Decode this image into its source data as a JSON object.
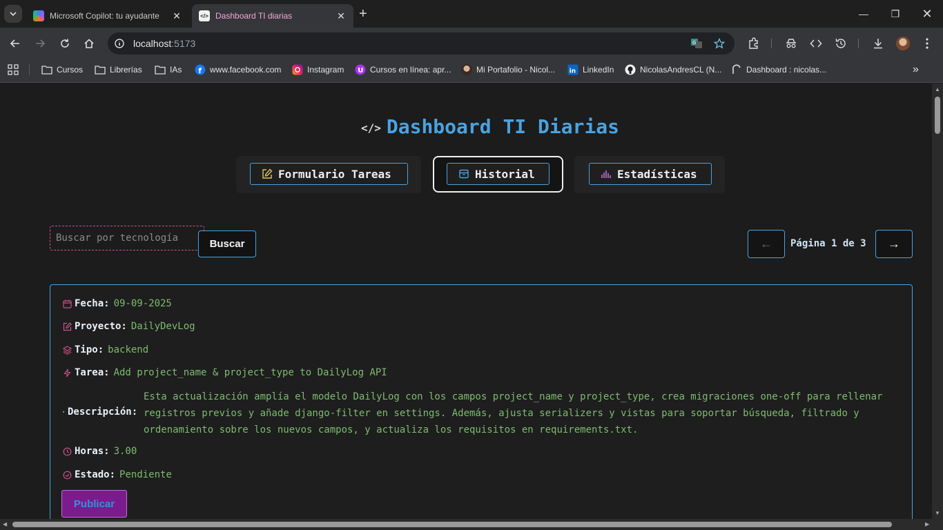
{
  "browser": {
    "tabs": [
      {
        "title": "Microsoft Copilot: tu ayudante"
      },
      {
        "title": "Dashboard TI diarias"
      }
    ],
    "url_host": "localhost",
    "url_port": ":5173",
    "bookmarks": [
      {
        "label": "Cursos"
      },
      {
        "label": "Librerías"
      },
      {
        "label": "IAs"
      },
      {
        "label": "www.facebook.com"
      },
      {
        "label": "Instagram"
      },
      {
        "label": "Cursos en línea: apr..."
      },
      {
        "label": "Mi Portafolio - Nicol..."
      },
      {
        "label": "LinkedIn"
      },
      {
        "label": "NicolasAndresCL (N..."
      },
      {
        "label": "Dashboard : nicolas..."
      }
    ]
  },
  "page": {
    "title": "Dashboard TI Diarias",
    "nav": [
      {
        "label": "Formulario Tareas",
        "icon": "edit-icon"
      },
      {
        "label": "Historial",
        "icon": "archive-icon",
        "active": true
      },
      {
        "label": "Estadísticas",
        "icon": "bar-chart-icon"
      }
    ],
    "search": {
      "placeholder": "Buscar por tecnología",
      "button_label": "Buscar"
    },
    "pagination": {
      "prev": "←",
      "next": "→",
      "text": "Página 1 de 3"
    },
    "entry": {
      "fecha_label": "Fecha:",
      "fecha": "09-09-2025",
      "proyecto_label": "Proyecto:",
      "proyecto": "DailyDevLog",
      "tipo_label": "Tipo:",
      "tipo": "backend",
      "tarea_label": "Tarea:",
      "tarea": "Add project_name & project_type to DailyLog API",
      "descripcion_label": "Descripción:",
      "descripcion": "Esta actualización amplía el modelo DailyLog con los campos project_name y project_type, crea migraciones one-off para rellenar registros previos y añade django-filter en settings. Además, ajusta serializers y vistas para soportar búsqueda, filtrado y ordenamiento sobre los nuevos campos, y actualiza los requisitos en requirements.txt.",
      "horas_label": "Horas:",
      "horas": "3.00",
      "estado_label": "Estado:",
      "estado": "Pendiente",
      "publish_label": "Publicar"
    }
  },
  "colors": {
    "accent": "#4aa3e0",
    "value_green": "#7dbb6f",
    "publish": "#7a1c8e"
  }
}
